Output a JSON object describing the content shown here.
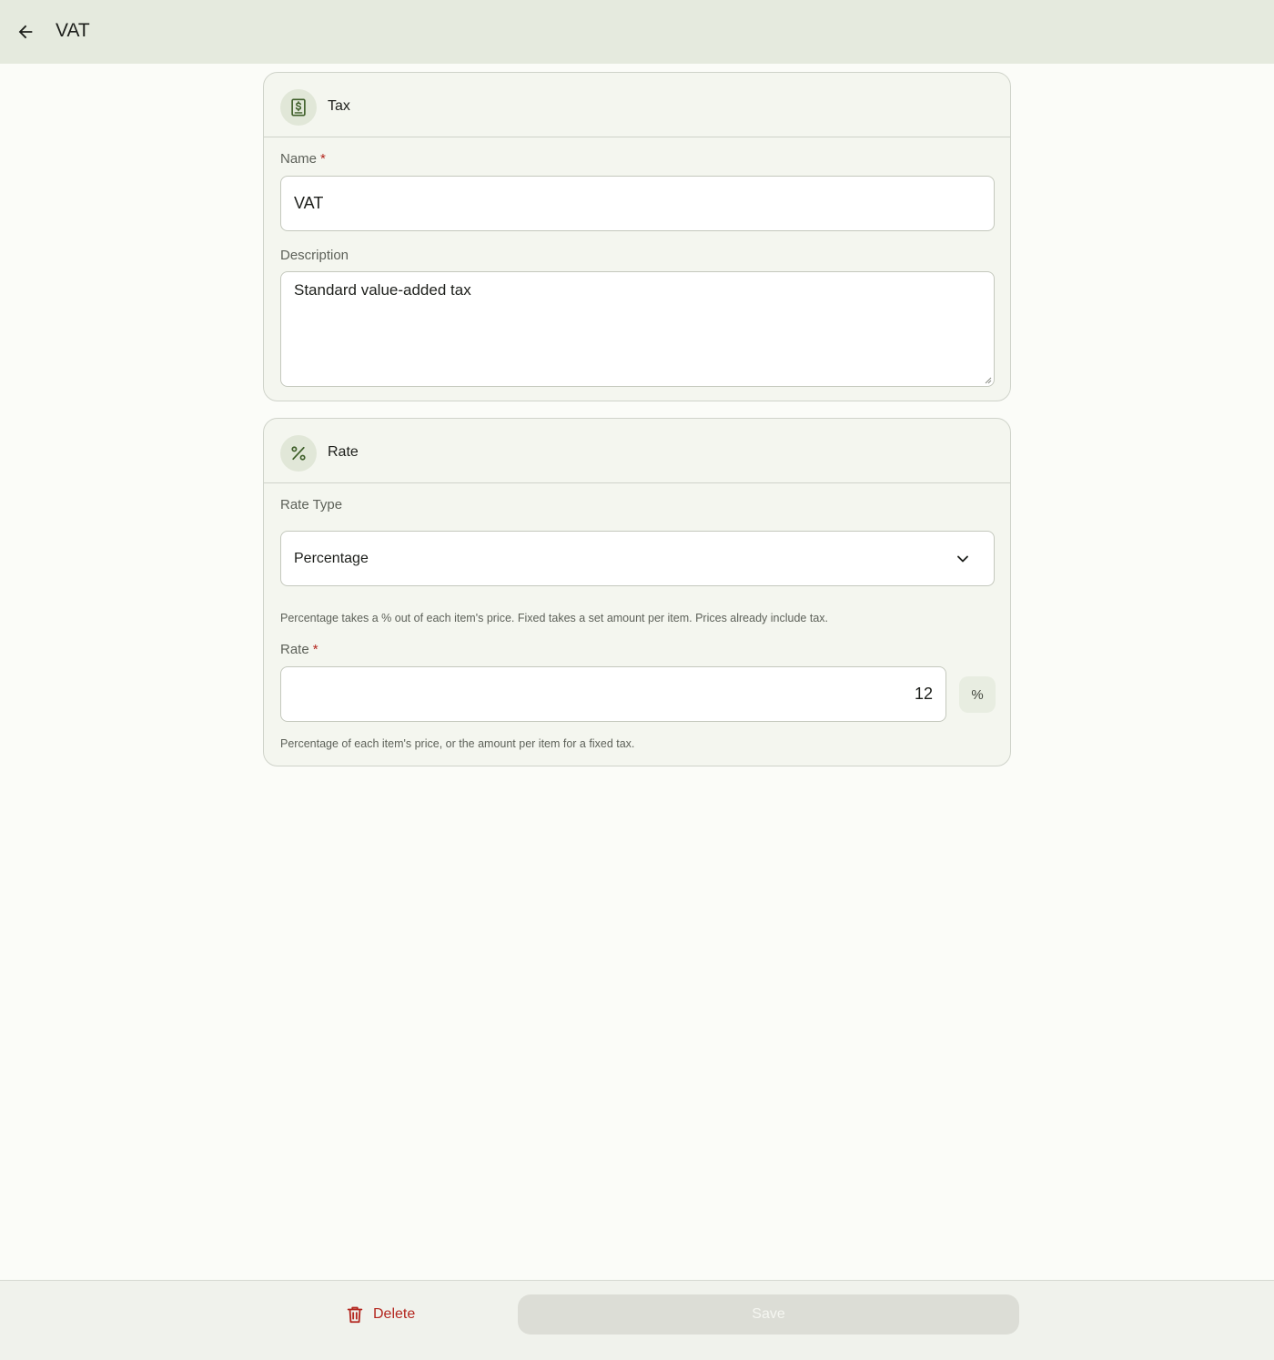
{
  "appbar": {
    "title": "VAT"
  },
  "tax_card": {
    "title": "Tax",
    "icon": "receipt-dollar-icon",
    "name_label": "Name",
    "required_mark": "*",
    "name_value": "VAT",
    "description_label": "Description",
    "description_value": "Standard value-added tax"
  },
  "rate_card": {
    "title": "Rate",
    "icon": "percent-icon",
    "rate_type_label": "Rate Type",
    "rate_type_value": "Percentage",
    "rate_type_helper": "Percentage takes a % out of each item's price. Fixed takes a set amount per item. Prices already include tax.",
    "rate_label": "Rate",
    "required_mark": "*",
    "rate_value": "12",
    "rate_suffix": "%",
    "rate_helper": "Percentage of each item's price, or the amount per item for a fixed tax."
  },
  "bottombar": {
    "delete_label": "Delete",
    "save_label": "Save"
  },
  "colors": {
    "appbar_bg": "#e5eade",
    "page_bg": "#fbfcf8",
    "card_bg": "#f4f6ef",
    "accent_icon": "#3f5f2a",
    "danger": "#b3261e",
    "disabled_button": "#dcddd6"
  }
}
